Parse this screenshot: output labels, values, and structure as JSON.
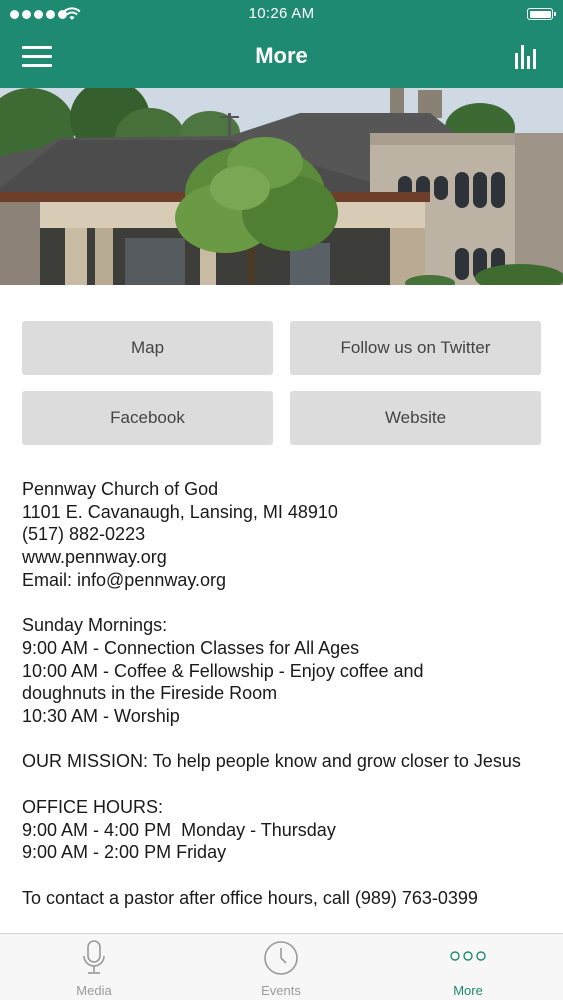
{
  "status_bar": {
    "time": "10:26 AM",
    "signal_icon": "signal-dots-icon",
    "wifi_icon": "wifi-icon",
    "battery_icon": "battery-icon",
    "battery_level": 1.0
  },
  "nav": {
    "title": "More",
    "menu_icon": "hamburger-menu-icon",
    "right_icon": "bar-chart-icon"
  },
  "hero": {
    "image": "church-building-photo"
  },
  "buttons": {
    "map": "Map",
    "twitter": "Follow us on Twitter",
    "facebook": "Facebook",
    "website": "Website"
  },
  "info": {
    "name": "Pennway Church of God",
    "address": "1101 E. Cavanaugh, Lansing, MI 48910",
    "phone": "(517) 882-0223",
    "web": "www.pennway.org",
    "email": "Email: info@pennway.org",
    "sunday_heading": "Sunday Mornings:",
    "sunday_1": "9:00 AM - Connection Classes for All Ages",
    "sunday_2": "10:00 AM - Coffee & Fellowship - Enjoy coffee and doughnuts in the Fireside Room",
    "sunday_3": "10:30 AM - Worship",
    "mission": "OUR MISSION: To help people know and grow closer to Jesus",
    "office_heading": "OFFICE HOURS:",
    "office_1": "9:00 AM - 4:00 PM  Monday - Thursday",
    "office_2": "9:00 AM - 2:00 PM Friday",
    "contact": "To contact a pastor after office hours, call (989) 763-0399"
  },
  "tabs": [
    {
      "label": "Media",
      "icon": "microphone-icon",
      "active": false
    },
    {
      "label": "Events",
      "icon": "clock-icon",
      "active": false
    },
    {
      "label": "More",
      "icon": "more-dots-icon",
      "active": true
    }
  ],
  "colors": {
    "brand": "#1f8a72",
    "button_bg": "#dcdcdc",
    "tab_inactive": "#9a9a9a"
  }
}
